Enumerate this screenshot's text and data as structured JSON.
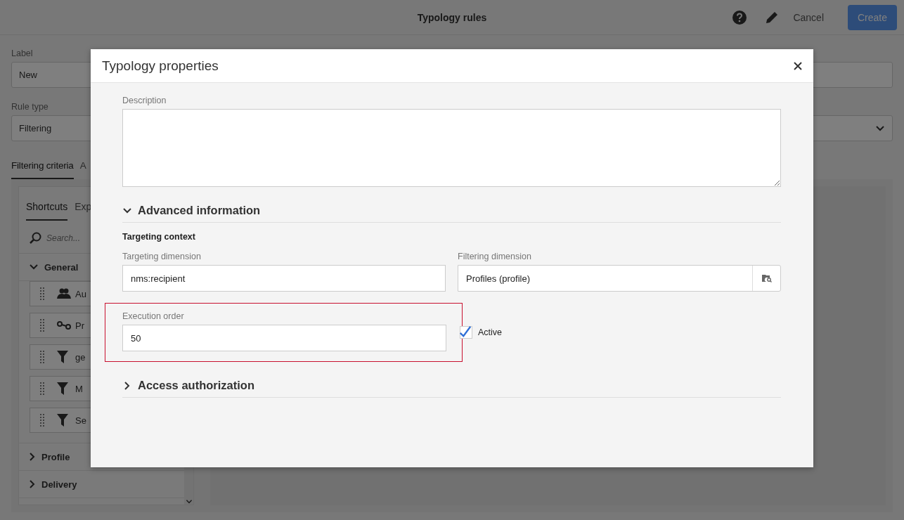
{
  "app": {
    "title": "Typology rules",
    "actions": {
      "cancel": "Cancel",
      "create": "Create"
    },
    "fields": [
      {
        "label": "Label",
        "value": "New",
        "kind": "text"
      },
      {
        "label": "Rule type",
        "value": "Filtering",
        "kind": "select"
      }
    ],
    "tabs": [
      {
        "label": "Filtering criteria",
        "selected": true
      },
      {
        "label": "A",
        "selected": false
      }
    ],
    "palette": {
      "tabs": [
        {
          "label": "Shortcuts",
          "selected": true
        },
        {
          "label": "Exp",
          "selected": false
        }
      ],
      "search": {
        "placeholder": "Search..."
      },
      "groups": [
        {
          "label": "General",
          "expanded": true,
          "items": [
            {
              "label": "Au",
              "kind": "people"
            },
            {
              "label": "Pr",
              "kind": "link"
            },
            {
              "label": "ge",
              "kind": "filter"
            },
            {
              "label": "M",
              "kind": "filter"
            },
            {
              "label": "Se",
              "kind": "filter"
            }
          ]
        },
        {
          "label": "Profile",
          "expanded": false
        },
        {
          "label": "Delivery",
          "expanded": false
        }
      ]
    }
  },
  "dialog": {
    "title": "Typology properties",
    "description": {
      "label": "Description"
    },
    "sections": [
      {
        "title": "Advanced information",
        "expanded": true,
        "content": {
          "heading": "Targeting context",
          "targeting_dimension": {
            "label": "Targeting dimension",
            "value": "nms:recipient"
          },
          "filtering_dimension": {
            "label": "Filtering dimension",
            "value": "Profiles (profile)"
          },
          "execution_order": {
            "label": "Execution order",
            "value": "50",
            "highlighted": true
          },
          "active": {
            "label": "Active",
            "checked": true
          }
        }
      },
      {
        "title": "Access authorization",
        "expanded": false
      }
    ]
  }
}
